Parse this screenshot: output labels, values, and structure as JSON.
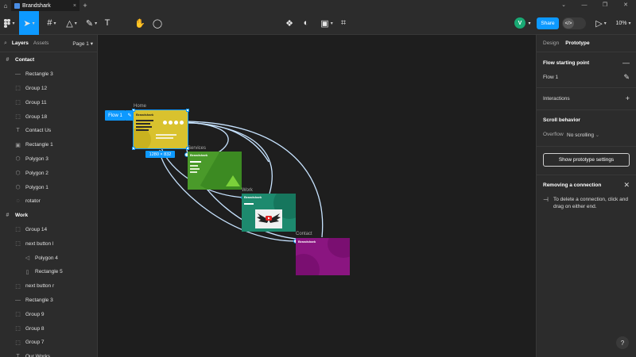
{
  "tab": {
    "title": "Brandshark",
    "close": "×",
    "add": "+"
  },
  "toolbar": {
    "avatar_initial": "V",
    "share_label": "Share",
    "zoom_label": "10%"
  },
  "left_panel": {
    "tabs": [
      "Layers",
      "Assets"
    ],
    "page_label": "Page 1",
    "layers": [
      {
        "label": "Contact",
        "icon": "#",
        "indent": 0,
        "kind": "frame"
      },
      {
        "label": "Rectangle 3",
        "icon": "—",
        "indent": 1,
        "kind": "layer"
      },
      {
        "label": "Group 12",
        "icon": "⬚",
        "indent": 1,
        "kind": "layer"
      },
      {
        "label": "Group 11",
        "icon": "⬚",
        "indent": 1,
        "kind": "layer"
      },
      {
        "label": "Group 18",
        "icon": "⬚",
        "indent": 1,
        "kind": "layer"
      },
      {
        "label": "Contact Us",
        "icon": "T",
        "indent": 1,
        "kind": "layer"
      },
      {
        "label": "Rectangle 1",
        "icon": "▣",
        "indent": 1,
        "kind": "layer"
      },
      {
        "label": "Polygon 3",
        "icon": "⬡",
        "indent": 1,
        "kind": "layer"
      },
      {
        "label": "Polygon 2",
        "icon": "⬡",
        "indent": 1,
        "kind": "layer"
      },
      {
        "label": "Polygon 1",
        "icon": "⬡",
        "indent": 1,
        "kind": "layer"
      },
      {
        "label": "rotator",
        "icon": "◌",
        "indent": 1,
        "kind": "layer"
      },
      {
        "label": "Work",
        "icon": "#",
        "indent": 0,
        "kind": "frame"
      },
      {
        "label": "Group 14",
        "icon": "⬚",
        "indent": 1,
        "kind": "layer"
      },
      {
        "label": "next button l",
        "icon": "⬚",
        "indent": 1,
        "kind": "layer"
      },
      {
        "label": "Polygon 4",
        "icon": "◁",
        "indent": 2,
        "kind": "layer"
      },
      {
        "label": "Rectangle 5",
        "icon": "▯",
        "indent": 2,
        "kind": "layer"
      },
      {
        "label": "next button r",
        "icon": "⬚",
        "indent": 1,
        "kind": "layer"
      },
      {
        "label": "Rectangle 3",
        "icon": "—",
        "indent": 1,
        "kind": "layer"
      },
      {
        "label": "Group 9",
        "icon": "⬚",
        "indent": 1,
        "kind": "layer"
      },
      {
        "label": "Group 8",
        "icon": "⬚",
        "indent": 1,
        "kind": "layer"
      },
      {
        "label": "Group 7",
        "icon": "⬚",
        "indent": 1,
        "kind": "layer"
      },
      {
        "label": "Our Works",
        "icon": "T",
        "indent": 1,
        "kind": "layer"
      }
    ]
  },
  "canvas": {
    "flow_chip": "Flow 1",
    "dimension_chip": "1280 × 832",
    "frames": [
      {
        "label": "Home",
        "color": "#d9c22e",
        "accent": "#c9b21f",
        "heading": "Brandshark"
      },
      {
        "label": "Services",
        "color": "#4a9a2a",
        "accent": "#3c8a22",
        "heading": "Brandshark"
      },
      {
        "label": "Work",
        "color": "#1d8a6e",
        "accent": "#16765d",
        "heading": "Brandshark"
      },
      {
        "label": "Contact",
        "color": "#8a1580",
        "accent": "#7a0f71",
        "heading": "Brandshark"
      }
    ],
    "connector_color": "#c7e3ff"
  },
  "right_panel": {
    "tabs": [
      "Design",
      "Prototype"
    ],
    "flow_section_title": "Flow starting point",
    "flow_name": "Flow 1",
    "interactions_title": "Interactions",
    "scroll_title": "Scroll behavior",
    "overflow_label": "Overflow",
    "overflow_value": "No scrolling",
    "settings_button": "Show prototype settings",
    "removing_title": "Removing a connection",
    "removing_text": "To delete a connection, click and drag on either end."
  },
  "help_label": "?"
}
